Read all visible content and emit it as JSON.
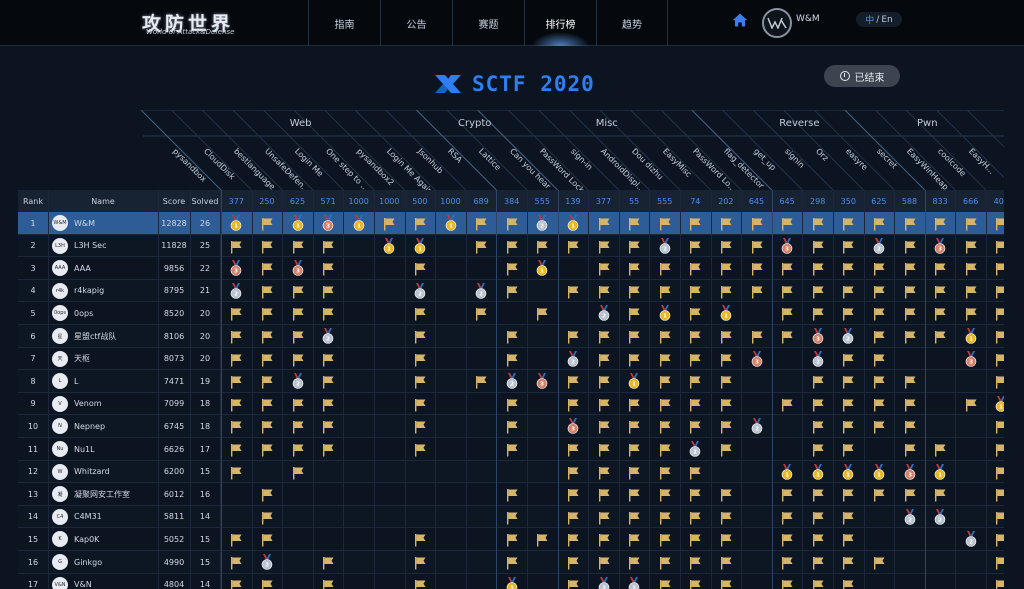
{
  "nav": {
    "logo_main": "攻防世界",
    "logo_sub": "World of Attack&Defense",
    "items": [
      "指南",
      "公告",
      "赛题",
      "排行榜",
      "趋势"
    ],
    "active": 3,
    "username": "W&M",
    "lang_zh": "中",
    "lang_sep": "/",
    "lang_en": "En"
  },
  "contest": {
    "title": "SCTF 2020",
    "status": "已结束"
  },
  "categories": [
    {
      "name": "Web"
    },
    {
      "name": "Crypto"
    },
    {
      "name": "Misc"
    },
    {
      "name": "Reverse"
    },
    {
      "name": "Pwn"
    }
  ],
  "columns": {
    "rank": "Rank",
    "name": "Name",
    "score": "Score",
    "solved": "Solved"
  },
  "challenges": [
    {
      "name": "pysandbox",
      "points": "377"
    },
    {
      "name": "CloudDisk",
      "points": "250"
    },
    {
      "name": "bestlanguage",
      "points": "625"
    },
    {
      "name": "UnsafeDefen...",
      "points": "571"
    },
    {
      "name": "Login Me",
      "points": "1000"
    },
    {
      "name": "One step to ...",
      "points": "1000"
    },
    {
      "name": "pysandbox2",
      "points": "500"
    },
    {
      "name": "Login Me Again",
      "points": "1000"
    },
    {
      "name": "Jsonhub",
      "points": "689"
    },
    {
      "name": "RSA",
      "points": "384"
    },
    {
      "name": "Lattice",
      "points": "555"
    },
    {
      "name": "Can you hear",
      "points": "139"
    },
    {
      "name": "PassWord Lock",
      "points": "377"
    },
    {
      "name": "sign-in",
      "points": "55"
    },
    {
      "name": "AndroidDispl...",
      "points": "555"
    },
    {
      "name": "Dou dizhu",
      "points": "74"
    },
    {
      "name": "EasyMisc",
      "points": "202"
    },
    {
      "name": "PassWord Lo...",
      "points": "645"
    },
    {
      "name": "flag_detector",
      "points": "645"
    },
    {
      "name": "get_up",
      "points": "298"
    },
    {
      "name": "signin",
      "points": "350"
    },
    {
      "name": "Orz",
      "points": "625"
    },
    {
      "name": "easyre",
      "points": "588"
    },
    {
      "name": "secret",
      "points": "833"
    },
    {
      "name": "EasyWinHeap",
      "points": "666"
    },
    {
      "name": "coolcode",
      "points": "400"
    },
    {
      "name": "EasyH...",
      "points": ""
    }
  ],
  "teams": [
    {
      "rank": "1",
      "name": "W&M",
      "score": "12828",
      "solved": "26",
      "avatar": "W&M",
      "solves": "g,f,g,b,g,f,f,g,f,f,s,g,f,f,f,f,f,f,f,f,f,f,f,f,f,f,f"
    },
    {
      "rank": "2",
      "name": "L3H Sec",
      "score": "11828",
      "solved": "25",
      "avatar": "L3H",
      "solves": "f,f,f,f,.,g,g,.,f,f,f,f,f,f,s,f,f,f,b,f,f,s,f,b,f,f,f"
    },
    {
      "rank": "3",
      "name": "AAA",
      "score": "9856",
      "solved": "22",
      "avatar": "AAA",
      "solves": "b,f,b,f,.,.,f,.,.,f,g,.,f,f,f,f,f,f,f,f,f,f,f,f,f,f,f"
    },
    {
      "rank": "4",
      "name": "r4kapig",
      "score": "8795",
      "solved": "21",
      "avatar": "r4k",
      "solves": "s,f,f,f,.,.,s,.,s,f,.,f,f,f,f,f,f,f,f,f,f,f,f,f,f,f,f"
    },
    {
      "rank": "5",
      "name": "0ops",
      "score": "8520",
      "solved": "20",
      "avatar": "0ops",
      "solves": "f,f,f,f,.,.,f,.,f,.,f,.,s,f,g,f,g,.,f,f,f,f,f,f,f,f,f"
    },
    {
      "rank": "6",
      "name": "星盟ctf战队",
      "score": "8106",
      "solved": "20",
      "avatar": "星",
      "solves": "f,f,f,s,.,.,f,.,.,f,.,f,f,f,f,f,f,f,f,b,s,f,f,f,g,f,."
    },
    {
      "rank": "7",
      "name": "天枢",
      "score": "8073",
      "solved": "20",
      "avatar": "天",
      "solves": "f,f,f,f,.,.,f,.,.,f,.,s,f,f,f,f,f,b,.,s,f,f,.,.,b,f,."
    },
    {
      "rank": "8",
      "name": "L",
      "score": "7471",
      "solved": "19",
      "avatar": "L",
      "solves": "f,f,s,f,.,.,f,.,f,s,b,f,f,g,f,f,f,.,.,f,f,f,f,.,.,f,."
    },
    {
      "rank": "9",
      "name": "Venom",
      "score": "7099",
      "solved": "18",
      "avatar": "V",
      "solves": "f,f,f,f,.,.,f,.,.,f,.,f,f,f,f,f,f,.,f,f,f,f,f,.,f,g,."
    },
    {
      "rank": "10",
      "name": "Nepnep",
      "score": "6745",
      "solved": "18",
      "avatar": "N",
      "solves": "f,f,f,f,.,.,f,.,.,f,.,b,f,f,f,f,f,s,.,f,f,f,f,.,.,f,."
    },
    {
      "rank": "11",
      "name": "Nu1L",
      "score": "6626",
      "solved": "17",
      "avatar": "Nu",
      "solves": "f,f,f,f,.,.,f,.,.,f,.,f,f,f,f,s,f,.,.,f,f,.,f,f,.,f,."
    },
    {
      "rank": "12",
      "name": "Whitzard",
      "score": "6200",
      "solved": "15",
      "avatar": "W",
      "solves": "f,.,f,.,.,.,.,.,.,.,.,f,f,f,f,f,.,.,g,g,g,g,b,g,.,f,."
    },
    {
      "rank": "13",
      "name": "凝聚网安工作室",
      "score": "6012",
      "solved": "16",
      "avatar": "凝",
      "solves": ".,f,.,.,.,.,.,.,.,f,.,f,f,f,f,f,f,.,f,f,f,f,f,f,.,f,."
    },
    {
      "rank": "14",
      "name": "C4M31",
      "score": "5811",
      "solved": "14",
      "avatar": "C4",
      "solves": ".,f,.,.,.,.,.,.,.,f,.,f,f,f,f,f,f,.,f,f,f,.,s,s,.,f,."
    },
    {
      "rank": "15",
      "name": "Kap0K",
      "score": "5052",
      "solved": "15",
      "avatar": "K",
      "solves": "f,f,.,.,.,.,f,.,.,f,f,f,f,f,f,f,f,.,f,f,f,.,.,.,s,f,."
    },
    {
      "rank": "16",
      "name": "Ginkgo",
      "score": "4990",
      "solved": "15",
      "avatar": "G",
      "solves": "f,s,.,f,.,.,f,.,.,f,.,f,f,f,f,f,f,.,f,f,f,f,.,.,.,f,."
    },
    {
      "rank": "17",
      "name": "V&N",
      "score": "4804",
      "solved": "14",
      "avatar": "V&N",
      "solves": "f,f,.,f,.,.,f,.,.,g,.,f,s,s,f,f,f,.,f,f,f,.,.,.,.,f,."
    }
  ],
  "colors": {
    "accent": "#2f7ff0",
    "gold": "#e8b823",
    "silver": "#b8c3cf",
    "bronze": "#d4826a",
    "flag": "#d6b56a"
  }
}
